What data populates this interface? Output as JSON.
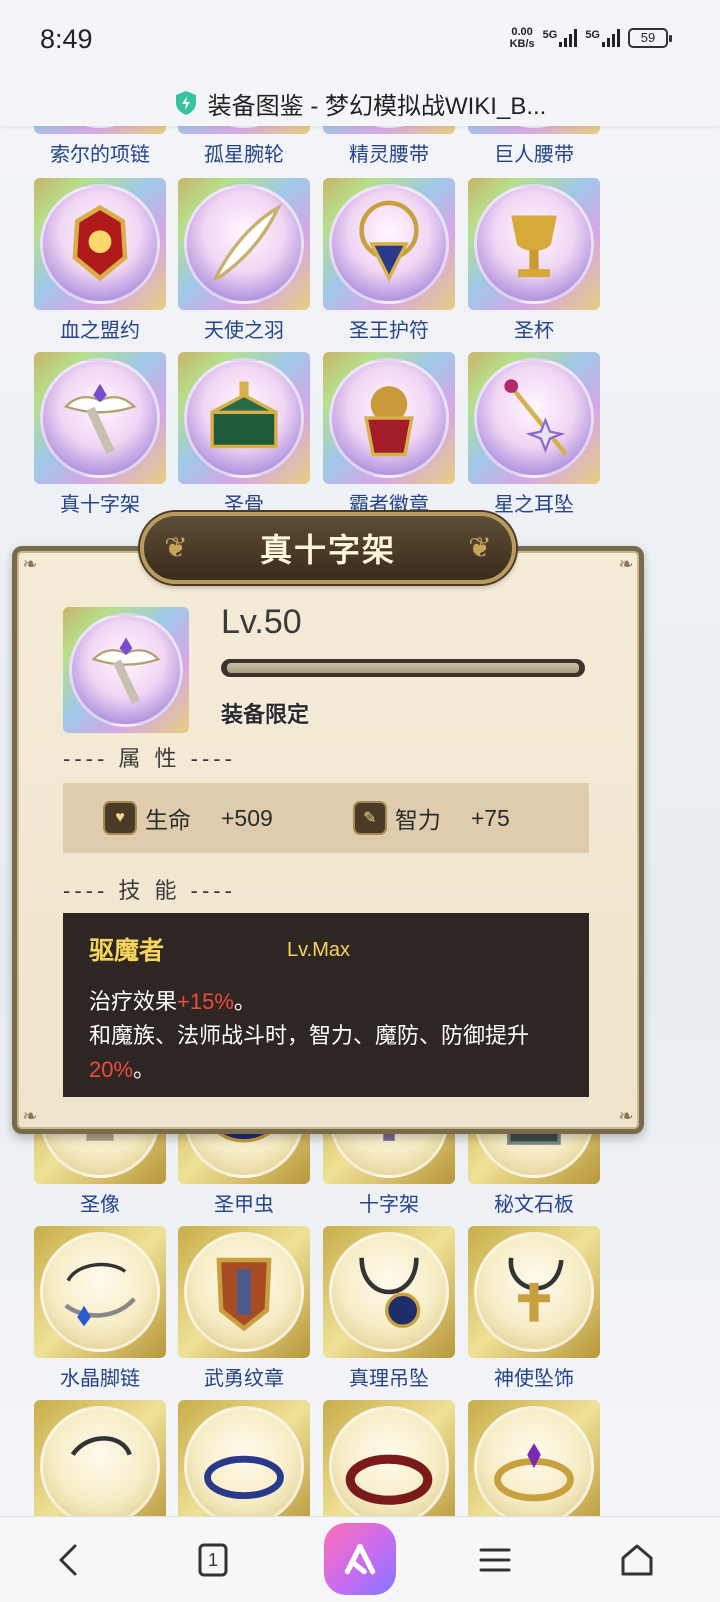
{
  "status_bar": {
    "time": "8:49",
    "net_speed_value": "0.00",
    "net_speed_unit": "KB/s",
    "sim1": "5G",
    "sim2": "5G",
    "battery": "59"
  },
  "browser": {
    "page_title": "装备图鉴 - 梦幻模拟战WIKI_B..."
  },
  "grid_rows": [
    [
      "索尔的项链",
      "孤星腕轮",
      "精灵腰带",
      "巨人腰带"
    ],
    [
      "血之盟约",
      "天使之羽",
      "圣王护符",
      "圣杯"
    ],
    [
      "真十字架",
      "圣骨",
      "霸者徽章",
      "星之耳坠"
    ],
    [
      "圣像",
      "圣甲虫",
      "十字架",
      "秘文石板"
    ],
    [
      "水晶脚链",
      "武勇纹章",
      "真理吊坠",
      "神使坠饰"
    ]
  ],
  "popup": {
    "title": "真十字架",
    "level": "Lv.50",
    "progress": 1.0,
    "limit_text": "装备限定",
    "attributes_label": "属 性",
    "attributes": [
      {
        "name": "生命",
        "value": "+509",
        "icon": "heart-icon"
      },
      {
        "name": "智力",
        "value": "+75",
        "icon": "scroll-icon"
      }
    ],
    "skills_label": "技 能",
    "skill": {
      "name": "驱魔者",
      "level": "Lv.Max",
      "line1_pre": "治疗效果",
      "line1_val": "+15%",
      "line1_post": "。",
      "line2_pre": "和魔族、法师战斗时，智力、魔防、防御提升",
      "line2_val": "20%",
      "line2_post": "。"
    }
  },
  "bottom_nav": {
    "tab_count": "1"
  }
}
